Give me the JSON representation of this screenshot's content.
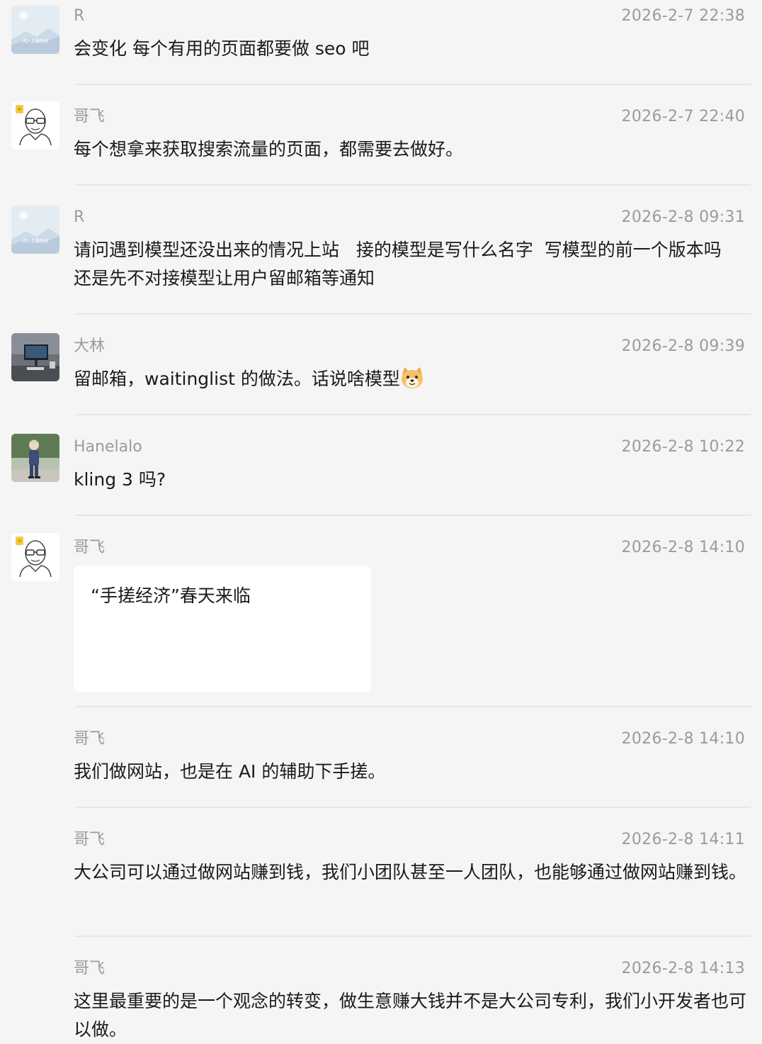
{
  "messages": [
    {
      "name": "R",
      "time": "2026-2-7 22:38",
      "text": "会变化  每个有用的页面都要做 seo 吧"
    },
    {
      "name": "哥飞",
      "time": "2026-2-7 22:40",
      "text": "每个想拿来获取搜索流量的页面，都需要去做好。"
    },
    {
      "name": "R",
      "time": "2026-2-8 09:31",
      "text": "请问遇到模型还没出来的情况上站   接的模型是写什么名字  写模型的前一个版本吗  还是先不对接模型让用户留邮箱等通知"
    },
    {
      "name": "大林",
      "time": "2026-2-8 09:39",
      "text": "留邮箱，waitinglist 的做法。话说啥模型"
    },
    {
      "name": "Hanelalo",
      "time": "2026-2-8 10:22",
      "text": "kling 3 吗?"
    },
    {
      "name": "哥飞",
      "time": "2026-2-8 14:10",
      "card_title": "“手搓经济”春天来临"
    },
    {
      "name": "哥飞",
      "time": "2026-2-8 14:10",
      "text": "我们做网站，也是在 AI 的辅助下手搓。"
    },
    {
      "name": "哥飞",
      "time": "2026-2-8 14:11",
      "text": "大公司可以通过做网站赚到钱，我们小团队甚至一人团队，也能够通过做网站赚到钱。"
    },
    {
      "name": "哥飞",
      "time": "2026-2-8 14:13",
      "text": "这里最重要的是一个观念的转变，做生意赚大钱并不是大公司专利，我们小开发者也可以做。"
    }
  ],
  "avatar_placeholder_caption": "图片加载失败",
  "colors": {
    "background": "#f5f5f5",
    "meta": "#9b9b9b",
    "text": "#1a1a1a",
    "divider": "#e6e6e6"
  }
}
